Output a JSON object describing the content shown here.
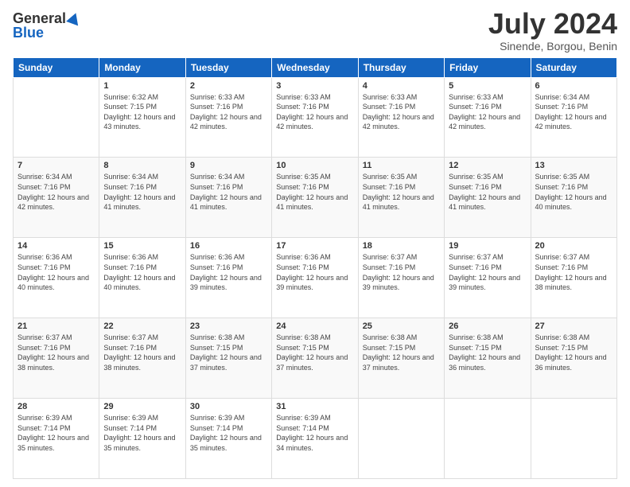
{
  "header": {
    "logo_general": "General",
    "logo_blue": "Blue",
    "month_title": "July 2024",
    "location": "Sinende, Borgou, Benin"
  },
  "calendar": {
    "days_of_week": [
      "Sunday",
      "Monday",
      "Tuesday",
      "Wednesday",
      "Thursday",
      "Friday",
      "Saturday"
    ],
    "weeks": [
      [
        {
          "day": "",
          "sunrise": "",
          "sunset": "",
          "daylight": ""
        },
        {
          "day": "1",
          "sunrise": "Sunrise: 6:32 AM",
          "sunset": "Sunset: 7:15 PM",
          "daylight": "Daylight: 12 hours and 43 minutes."
        },
        {
          "day": "2",
          "sunrise": "Sunrise: 6:33 AM",
          "sunset": "Sunset: 7:16 PM",
          "daylight": "Daylight: 12 hours and 42 minutes."
        },
        {
          "day": "3",
          "sunrise": "Sunrise: 6:33 AM",
          "sunset": "Sunset: 7:16 PM",
          "daylight": "Daylight: 12 hours and 42 minutes."
        },
        {
          "day": "4",
          "sunrise": "Sunrise: 6:33 AM",
          "sunset": "Sunset: 7:16 PM",
          "daylight": "Daylight: 12 hours and 42 minutes."
        },
        {
          "day": "5",
          "sunrise": "Sunrise: 6:33 AM",
          "sunset": "Sunset: 7:16 PM",
          "daylight": "Daylight: 12 hours and 42 minutes."
        },
        {
          "day": "6",
          "sunrise": "Sunrise: 6:34 AM",
          "sunset": "Sunset: 7:16 PM",
          "daylight": "Daylight: 12 hours and 42 minutes."
        }
      ],
      [
        {
          "day": "7",
          "sunrise": "Sunrise: 6:34 AM",
          "sunset": "Sunset: 7:16 PM",
          "daylight": "Daylight: 12 hours and 42 minutes."
        },
        {
          "day": "8",
          "sunrise": "Sunrise: 6:34 AM",
          "sunset": "Sunset: 7:16 PM",
          "daylight": "Daylight: 12 hours and 41 minutes."
        },
        {
          "day": "9",
          "sunrise": "Sunrise: 6:34 AM",
          "sunset": "Sunset: 7:16 PM",
          "daylight": "Daylight: 12 hours and 41 minutes."
        },
        {
          "day": "10",
          "sunrise": "Sunrise: 6:35 AM",
          "sunset": "Sunset: 7:16 PM",
          "daylight": "Daylight: 12 hours and 41 minutes."
        },
        {
          "day": "11",
          "sunrise": "Sunrise: 6:35 AM",
          "sunset": "Sunset: 7:16 PM",
          "daylight": "Daylight: 12 hours and 41 minutes."
        },
        {
          "day": "12",
          "sunrise": "Sunrise: 6:35 AM",
          "sunset": "Sunset: 7:16 PM",
          "daylight": "Daylight: 12 hours and 41 minutes."
        },
        {
          "day": "13",
          "sunrise": "Sunrise: 6:35 AM",
          "sunset": "Sunset: 7:16 PM",
          "daylight": "Daylight: 12 hours and 40 minutes."
        }
      ],
      [
        {
          "day": "14",
          "sunrise": "Sunrise: 6:36 AM",
          "sunset": "Sunset: 7:16 PM",
          "daylight": "Daylight: 12 hours and 40 minutes."
        },
        {
          "day": "15",
          "sunrise": "Sunrise: 6:36 AM",
          "sunset": "Sunset: 7:16 PM",
          "daylight": "Daylight: 12 hours and 40 minutes."
        },
        {
          "day": "16",
          "sunrise": "Sunrise: 6:36 AM",
          "sunset": "Sunset: 7:16 PM",
          "daylight": "Daylight: 12 hours and 39 minutes."
        },
        {
          "day": "17",
          "sunrise": "Sunrise: 6:36 AM",
          "sunset": "Sunset: 7:16 PM",
          "daylight": "Daylight: 12 hours and 39 minutes."
        },
        {
          "day": "18",
          "sunrise": "Sunrise: 6:37 AM",
          "sunset": "Sunset: 7:16 PM",
          "daylight": "Daylight: 12 hours and 39 minutes."
        },
        {
          "day": "19",
          "sunrise": "Sunrise: 6:37 AM",
          "sunset": "Sunset: 7:16 PM",
          "daylight": "Daylight: 12 hours and 39 minutes."
        },
        {
          "day": "20",
          "sunrise": "Sunrise: 6:37 AM",
          "sunset": "Sunset: 7:16 PM",
          "daylight": "Daylight: 12 hours and 38 minutes."
        }
      ],
      [
        {
          "day": "21",
          "sunrise": "Sunrise: 6:37 AM",
          "sunset": "Sunset: 7:16 PM",
          "daylight": "Daylight: 12 hours and 38 minutes."
        },
        {
          "day": "22",
          "sunrise": "Sunrise: 6:37 AM",
          "sunset": "Sunset: 7:16 PM",
          "daylight": "Daylight: 12 hours and 38 minutes."
        },
        {
          "day": "23",
          "sunrise": "Sunrise: 6:38 AM",
          "sunset": "Sunset: 7:15 PM",
          "daylight": "Daylight: 12 hours and 37 minutes."
        },
        {
          "day": "24",
          "sunrise": "Sunrise: 6:38 AM",
          "sunset": "Sunset: 7:15 PM",
          "daylight": "Daylight: 12 hours and 37 minutes."
        },
        {
          "day": "25",
          "sunrise": "Sunrise: 6:38 AM",
          "sunset": "Sunset: 7:15 PM",
          "daylight": "Daylight: 12 hours and 37 minutes."
        },
        {
          "day": "26",
          "sunrise": "Sunrise: 6:38 AM",
          "sunset": "Sunset: 7:15 PM",
          "daylight": "Daylight: 12 hours and 36 minutes."
        },
        {
          "day": "27",
          "sunrise": "Sunrise: 6:38 AM",
          "sunset": "Sunset: 7:15 PM",
          "daylight": "Daylight: 12 hours and 36 minutes."
        }
      ],
      [
        {
          "day": "28",
          "sunrise": "Sunrise: 6:39 AM",
          "sunset": "Sunset: 7:14 PM",
          "daylight": "Daylight: 12 hours and 35 minutes."
        },
        {
          "day": "29",
          "sunrise": "Sunrise: 6:39 AM",
          "sunset": "Sunset: 7:14 PM",
          "daylight": "Daylight: 12 hours and 35 minutes."
        },
        {
          "day": "30",
          "sunrise": "Sunrise: 6:39 AM",
          "sunset": "Sunset: 7:14 PM",
          "daylight": "Daylight: 12 hours and 35 minutes."
        },
        {
          "day": "31",
          "sunrise": "Sunrise: 6:39 AM",
          "sunset": "Sunset: 7:14 PM",
          "daylight": "Daylight: 12 hours and 34 minutes."
        },
        {
          "day": "",
          "sunrise": "",
          "sunset": "",
          "daylight": ""
        },
        {
          "day": "",
          "sunrise": "",
          "sunset": "",
          "daylight": ""
        },
        {
          "day": "",
          "sunrise": "",
          "sunset": "",
          "daylight": ""
        }
      ]
    ]
  }
}
